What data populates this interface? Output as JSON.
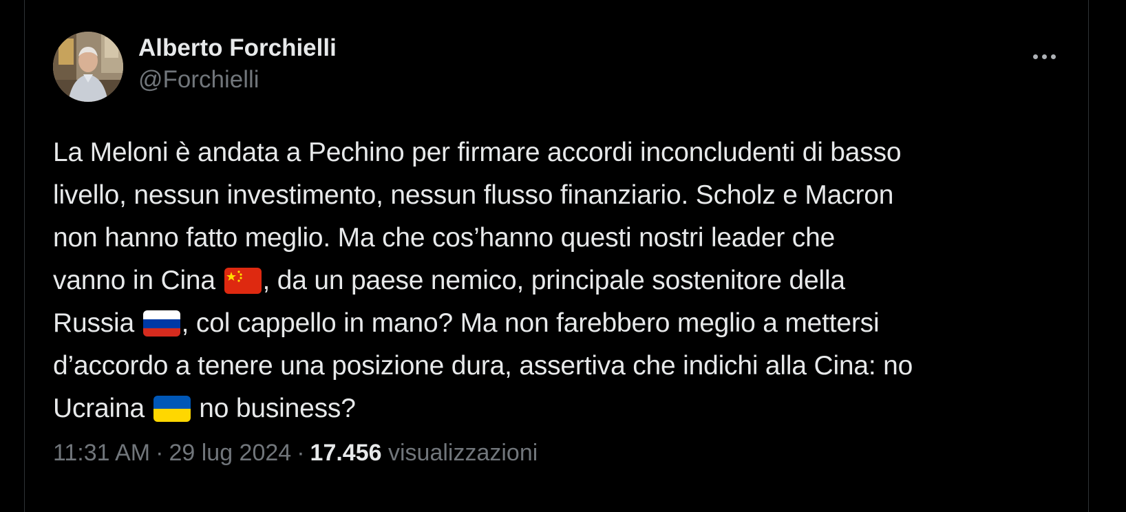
{
  "author": {
    "display_name": "Alberto Forchielli",
    "handle": "@Forchielli"
  },
  "menu": {
    "icon": "more-horizontal-icon"
  },
  "tweet": {
    "line1": "La Meloni è andata a Pechino per firmare accordi inconcludenti di basso",
    "line2": "livello, nessun investimento, nessun flusso finanziario. Scholz e Macron",
    "line3": "non hanno fatto meglio. Ma che cos’hanno questi nostri leader che",
    "line4_a": "vanno in Cina ",
    "line4_b": ", da un paese nemico, principale sostenitore della",
    "line5_a": "Russia ",
    "line5_b": ", col cappello in mano? Ma non farebbero meglio a mettersi",
    "line6": "d’accordo a tenere una posizione dura, assertiva che indichi alla Cina: no",
    "line7_a": "Ucraina ",
    "line7_b": " no business?",
    "flags": {
      "china": "china-flag-icon",
      "russia": "russia-flag-icon",
      "ukraine": "ukraine-flag-icon"
    }
  },
  "meta": {
    "time": "11:31 AM",
    "separator": "·",
    "date": "29 lug 2024",
    "views_count": "17.456",
    "views_label": "visualizzazioni"
  },
  "colors": {
    "background": "#000000",
    "text_primary": "#e7e9ea",
    "text_secondary": "#71767b",
    "border": "#2f3336"
  }
}
